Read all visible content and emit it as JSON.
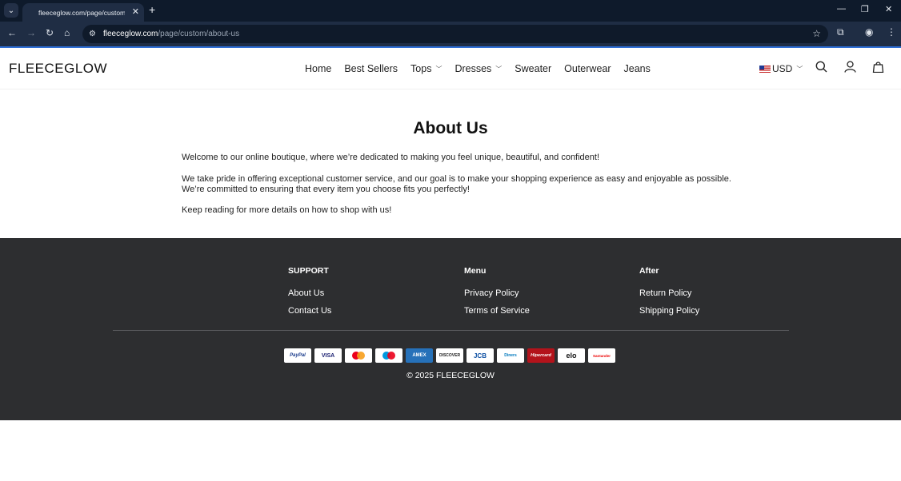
{
  "browser": {
    "tab_title": "fleeceglow.com/page/custom/a",
    "url_domain": "fleeceglow.com",
    "url_path": "/page/custom/about-us"
  },
  "header": {
    "logo": "FLEECEGLOW",
    "nav": [
      {
        "label": "Home",
        "has_dropdown": false
      },
      {
        "label": "Best Sellers",
        "has_dropdown": false
      },
      {
        "label": "Tops",
        "has_dropdown": true
      },
      {
        "label": "Dresses",
        "has_dropdown": true
      },
      {
        "label": "Sweater",
        "has_dropdown": false
      },
      {
        "label": "Outerwear",
        "has_dropdown": false
      },
      {
        "label": "Jeans",
        "has_dropdown": false
      }
    ],
    "currency": "USD"
  },
  "content": {
    "title": "About Us",
    "para1": "Welcome to our online boutique, where we’re dedicated to making you feel unique, beautiful, and confident!",
    "para2_line1": "We take pride in offering exceptional customer service, and our goal is to make your shopping experience as easy and enjoyable as possible.",
    "para2_line2": "We’re committed to ensuring that every item you choose fits you perfectly!",
    "para3": "Keep reading for more details on how to shop with us!"
  },
  "footer": {
    "columns": [
      {
        "heading": "SUPPORT",
        "links": [
          "About Us",
          "Contact Us"
        ]
      },
      {
        "heading": "Menu",
        "links": [
          "Privacy Policy",
          "Terms of Service"
        ]
      },
      {
        "heading": "After",
        "links": [
          "Return Policy",
          "Shipping Policy"
        ]
      }
    ],
    "payments": [
      "PayPal",
      "VISA",
      "mastercard",
      "maestro",
      "AMEX",
      "DISCOVER",
      "JCB",
      "Diners",
      "Hipercard",
      "elo",
      "Santander"
    ],
    "copyright": "© 2025 FLEECEGLOW"
  }
}
